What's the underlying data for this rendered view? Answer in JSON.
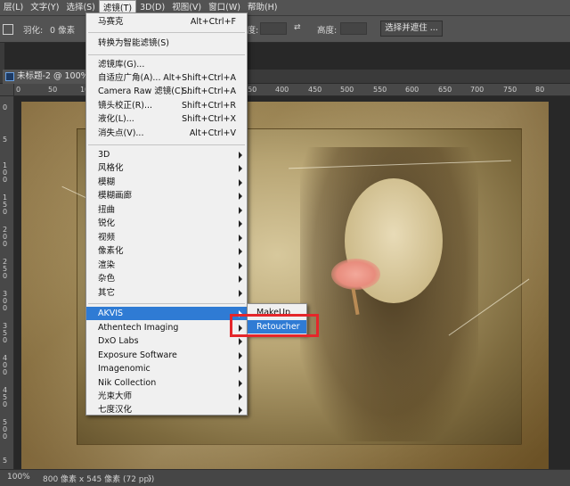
{
  "menubar": {
    "items": [
      {
        "label": "层(L)",
        "active": false
      },
      {
        "label": "文字(Y)",
        "active": false
      },
      {
        "label": "选择(S)",
        "active": false
      },
      {
        "label": "滤镜(T)",
        "active": true
      },
      {
        "label": "3D(D)",
        "active": false
      },
      {
        "label": "视图(V)",
        "active": false
      },
      {
        "label": "窗口(W)",
        "active": false
      },
      {
        "label": "帮助(H)",
        "active": false
      }
    ]
  },
  "options": {
    "feather_label": "羽化:",
    "feather_value": "0 像素",
    "width_label": "宽度:",
    "height_label": "高度:",
    "select_mask_button": "选择并遮住 ..."
  },
  "document": {
    "tab_label": "未标题-2 @ 100% (图"
  },
  "rulers": {
    "h_ticks": [
      "0",
      "50",
      "100",
      "150",
      "200",
      "250",
      "300",
      "350",
      "400",
      "450",
      "500",
      "550",
      "600",
      "650",
      "700",
      "750",
      "80"
    ],
    "v_ticks": [
      "0",
      "5",
      "1 0 0",
      "1 5 0",
      "2 0 0",
      "2 5 0",
      "3 0 0",
      "3 5 0",
      "4 0 0",
      "4 5 0",
      "5 0 0",
      "5"
    ]
  },
  "status": {
    "zoom": "100%",
    "doc_info": "800 像素 x 545 像素 (72 ppi)",
    "arrow": "〉"
  },
  "filter_menu": {
    "top_items": [
      {
        "label": "马赛克",
        "shortcut": "Alt+Ctrl+F"
      },
      {
        "label": "转换为智能滤镜(S)",
        "shortcut": ""
      }
    ],
    "middle_items": [
      {
        "label": "滤镜库(G)...",
        "shortcut": ""
      },
      {
        "label": "自适应广角(A)...",
        "shortcut": "Alt+Shift+Ctrl+A"
      },
      {
        "label": "Camera Raw 滤镜(C)...",
        "shortcut": "Shift+Ctrl+A"
      },
      {
        "label": "镜头校正(R)...",
        "shortcut": "Shift+Ctrl+R"
      },
      {
        "label": "液化(L)...",
        "shortcut": "Shift+Ctrl+X"
      },
      {
        "label": "消失点(V)...",
        "shortcut": "Alt+Ctrl+V"
      }
    ],
    "sub_items": [
      "3D",
      "风格化",
      "模糊",
      "模糊画廊",
      "扭曲",
      "锐化",
      "视频",
      "像素化",
      "渲染",
      "杂色",
      "其它"
    ],
    "plugin_items": [
      "AKVIS",
      "Athentech Imaging",
      "DxO Labs",
      "Exposure Software",
      "Imagenomic",
      "Nik Collection",
      "光束大师",
      "七度汉化"
    ]
  },
  "akvis_submenu": {
    "items": [
      "MakeUp",
      "Retoucher"
    ]
  },
  "colors": {
    "highlight": "#2f7bd4",
    "annotation_box": "#e5262a"
  }
}
